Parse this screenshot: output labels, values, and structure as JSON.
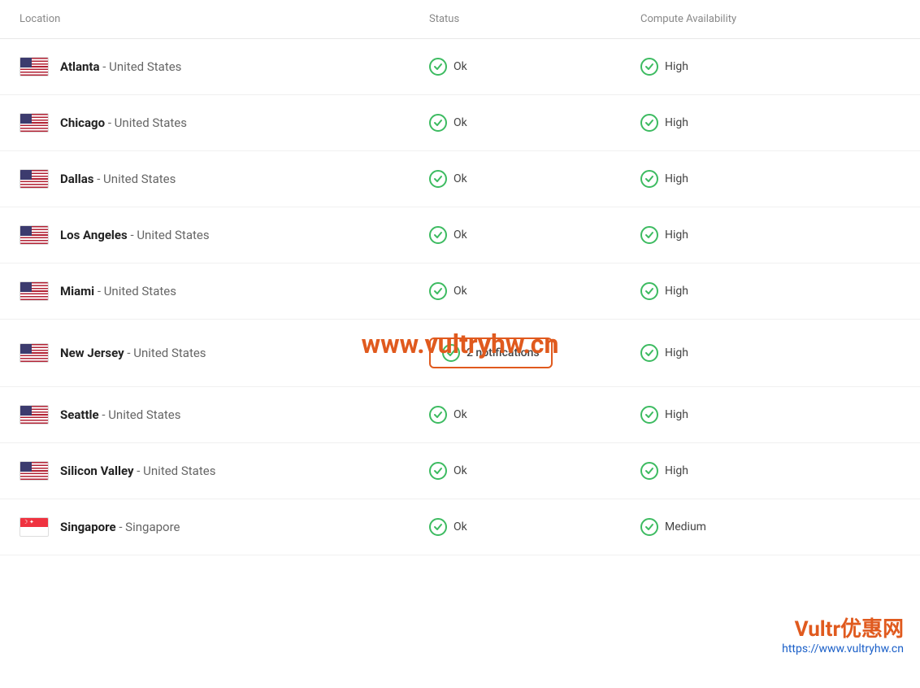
{
  "header": {
    "col_location": "Location",
    "col_status": "Status",
    "col_availability": "Compute Availability"
  },
  "rows": [
    {
      "id": "atlanta",
      "flag": "us",
      "city": "Atlanta",
      "region": "United States",
      "status_label": "Ok",
      "status_type": "ok",
      "availability_label": "High",
      "availability_type": "ok"
    },
    {
      "id": "chicago",
      "flag": "us",
      "city": "Chicago",
      "region": "United States",
      "status_label": "Ok",
      "status_type": "ok",
      "availability_label": "High",
      "availability_type": "ok"
    },
    {
      "id": "dallas",
      "flag": "us",
      "city": "Dallas",
      "region": "United States",
      "status_label": "Ok",
      "status_type": "ok",
      "availability_label": "High",
      "availability_type": "ok"
    },
    {
      "id": "los-angeles",
      "flag": "us",
      "city": "Los Angeles",
      "region": "United States",
      "status_label": "Ok",
      "status_type": "ok",
      "availability_label": "High",
      "availability_type": "ok"
    },
    {
      "id": "miami",
      "flag": "us",
      "city": "Miami",
      "region": "United States",
      "status_label": "Ok",
      "status_type": "ok",
      "availability_label": "High",
      "availability_type": "ok"
    },
    {
      "id": "new-jersey",
      "flag": "us",
      "city": "New Jersey",
      "region": "United States",
      "status_label": "2 notifications",
      "status_type": "notification",
      "availability_label": "High",
      "availability_type": "ok"
    },
    {
      "id": "seattle",
      "flag": "us",
      "city": "Seattle",
      "region": "United States",
      "status_label": "Ok",
      "status_type": "ok",
      "availability_label": "High",
      "availability_type": "ok"
    },
    {
      "id": "silicon-valley",
      "flag": "us",
      "city": "Silicon Valley",
      "region": "United States",
      "status_label": "Ok",
      "status_type": "ok",
      "availability_label": "High",
      "availability_type": "ok"
    },
    {
      "id": "singapore",
      "flag": "sg",
      "city": "Singapore",
      "region": "Singapore",
      "status_label": "Ok",
      "status_type": "ok",
      "availability_label": "Medium",
      "availability_type": "ok"
    }
  ],
  "watermark": "www.vultryhw.cn",
  "watermark2_brand": "Vultr",
  "watermark2_suffix": "优惠网",
  "watermark2_url": "https://www.vultryhw.cn"
}
